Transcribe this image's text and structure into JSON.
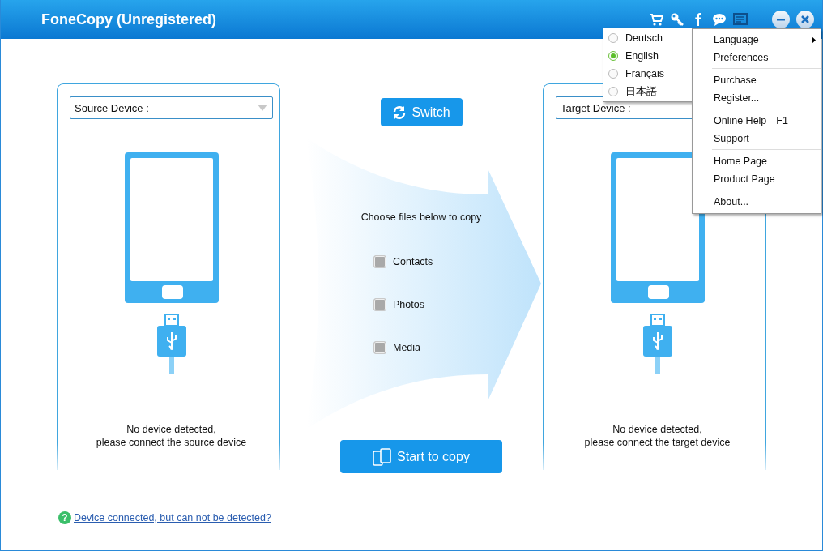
{
  "window": {
    "title": "FoneCopy (Unregistered)"
  },
  "source": {
    "dropdown_label": "Source Device :",
    "status_lines": [
      "No device detected,",
      "please connect the source device"
    ]
  },
  "target": {
    "dropdown_label": "Target Device :",
    "status_lines": [
      "No device detected,",
      "please connect the target device"
    ]
  },
  "switch_button": "Switch",
  "instruction": "Choose files below to copy",
  "file_types": [
    {
      "label": "Contacts",
      "checked": false,
      "disabled": true
    },
    {
      "label": "Photos",
      "checked": false,
      "disabled": true
    },
    {
      "label": "Media",
      "checked": false,
      "disabled": true
    }
  ],
  "start_button": "Start to copy",
  "help_icon": "?",
  "help_link": "Device connected, but can not be detected?",
  "menu": {
    "groups": [
      [
        {
          "label": "Language",
          "has_submenu": true
        },
        {
          "label": "Preferences",
          "has_submenu": false
        }
      ],
      [
        {
          "label": "Purchase",
          "has_submenu": false
        },
        {
          "label": "Register...",
          "has_submenu": false
        }
      ],
      [
        {
          "label": "Online Help",
          "shortcut": "F1",
          "has_submenu": false
        },
        {
          "label": "Support",
          "has_submenu": false
        }
      ],
      [
        {
          "label": "Home Page",
          "has_submenu": false
        },
        {
          "label": "Product Page",
          "has_submenu": false
        }
      ],
      [
        {
          "label": "About...",
          "has_submenu": false
        }
      ]
    ]
  },
  "language_menu": [
    {
      "label": "Deutsch",
      "selected": false
    },
    {
      "label": "English",
      "selected": true
    },
    {
      "label": "Français",
      "selected": false
    },
    {
      "label": "日本語",
      "selected": false
    }
  ]
}
